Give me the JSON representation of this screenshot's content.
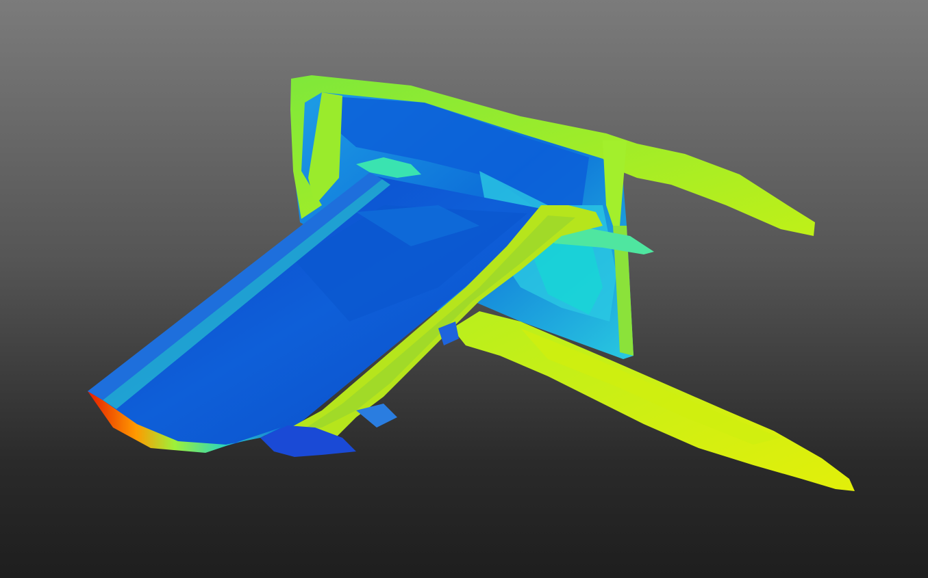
{
  "viewport": {
    "background_top": "#7b7b7b",
    "background_bottom": "#1e1e1e"
  },
  "scene": {
    "subject": "3d-cfd-render",
    "colormap": [
      "#0b3fd6",
      "#0a6ee0",
      "#12a6e6",
      "#21d7e3",
      "#40e9a8",
      "#8af04a",
      "#c8ef1a",
      "#e6e600",
      "#ff7a00",
      "#e41b00"
    ]
  }
}
